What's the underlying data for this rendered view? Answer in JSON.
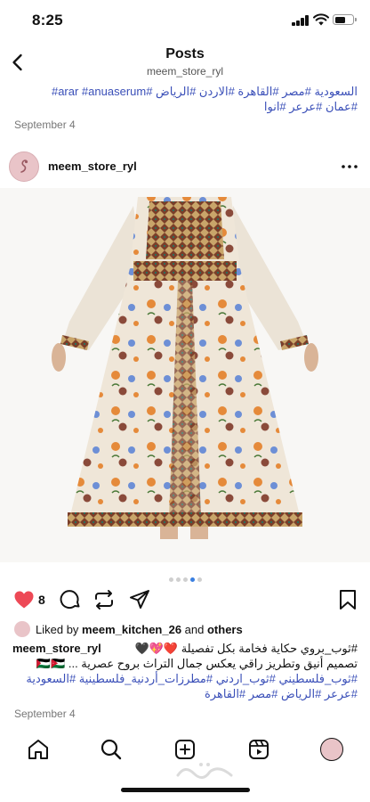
{
  "status_bar": {
    "time": "8:25"
  },
  "header": {
    "title": "Posts",
    "subtitle": "meem_store_ryl"
  },
  "top_caption": {
    "line1": "السعودية #مصر #القاهرة #الاردن #الرياض #arar #anuaserum#",
    "line2": "#عمان #عرعر #انوا"
  },
  "top_date": "September 4",
  "post": {
    "username": "meem_store_ryl",
    "like_count": "8",
    "liked_by_prefix": "Liked by ",
    "liked_by_user": "meem_kitchen_26",
    "liked_by_and": " and ",
    "liked_by_others": "others",
    "caption_user": "meem_store_ryl",
    "caption_line1": "#ثوب_بروي حكاية فخامة بكل تفصيلة ❤️💖🖤",
    "caption_line2": "تصميم أنيق وتطريز راقي يعكس جمال التراث بروح عصرية ... 🇵🇸🇯🇴",
    "caption_line3": "#ثوب_فلسطيني #ثوب_اردني #مطرزات_أردنية_فلسطينية #السعودية",
    "caption_line4": "#عرعر #الرياض #مصر #القاهرة",
    "date": "September 4",
    "carousel_total": 5,
    "carousel_active": 4
  },
  "icons": {
    "back": "chevron-left-icon",
    "more": "more-dots-icon",
    "like": "heart-filled-icon",
    "comment": "comment-icon",
    "repost": "repost-icon",
    "share": "send-icon",
    "save": "bookmark-icon",
    "home": "home-icon",
    "search": "search-icon",
    "create": "create-icon",
    "reels": "reels-icon",
    "profile": "profile-avatar-icon"
  },
  "colors": {
    "like": "#ed4956",
    "hashtag": "#3a4fb8",
    "carousel_active": "#3a7fe0"
  }
}
